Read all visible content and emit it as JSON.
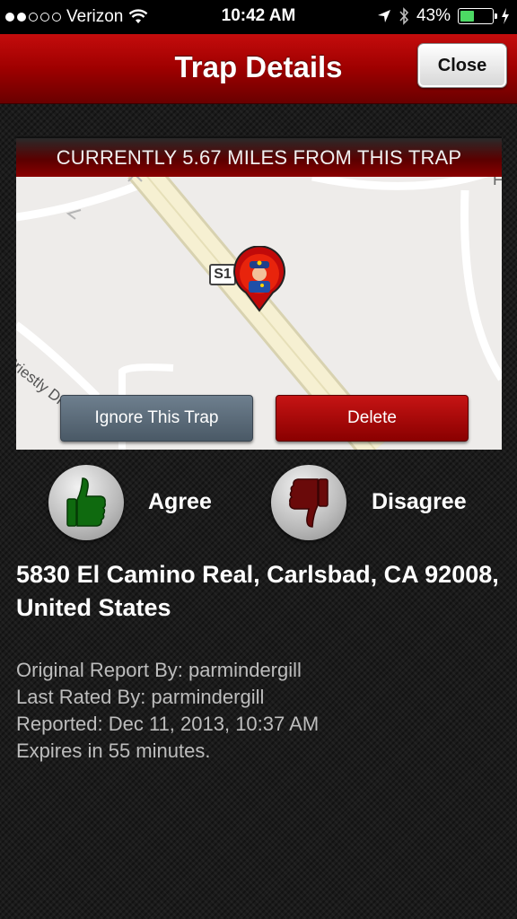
{
  "status_bar": {
    "carrier": "Verizon",
    "time": "10:42 AM",
    "battery": "43%",
    "battery_level": 0.43,
    "signal_bars": 2,
    "icons": [
      "wifi-icon",
      "location-arrow-icon",
      "bluetooth-icon",
      "battery-icon",
      "charging-bolt-icon"
    ]
  },
  "nav": {
    "title": "Trap Details",
    "close_label": "Close"
  },
  "map": {
    "distance_banner": "CURRENTLY 5.67 MILES FROM THIS TRAP",
    "road_shield": "S1",
    "street_label": "Priestly Dr",
    "edge_label": "F",
    "marker_icon": "police-officer-icon",
    "ignore_label": "Ignore This Trap",
    "delete_label": "Delete"
  },
  "rating": {
    "agree_label": "Agree",
    "disagree_label": "Disagree",
    "agree_icon": "thumbs-up-icon",
    "disagree_icon": "thumbs-down-icon",
    "agree_color": "#0f6a0f",
    "disagree_color": "#6a0a0a"
  },
  "details": {
    "address": "5830 El Camino Real, Carlsbad, CA 92008, United States",
    "reported_by": "Original Report By: parmindergill",
    "rated_by": "Last Rated By: parmindergill",
    "reported_at": "Reported: Dec 11, 2013, 10:37 AM",
    "expires": "Expires in 55 minutes."
  },
  "colors": {
    "nav_red": "#b00000",
    "delete_red": "#a80a0a",
    "ignore_slate": "#5b6a78"
  }
}
